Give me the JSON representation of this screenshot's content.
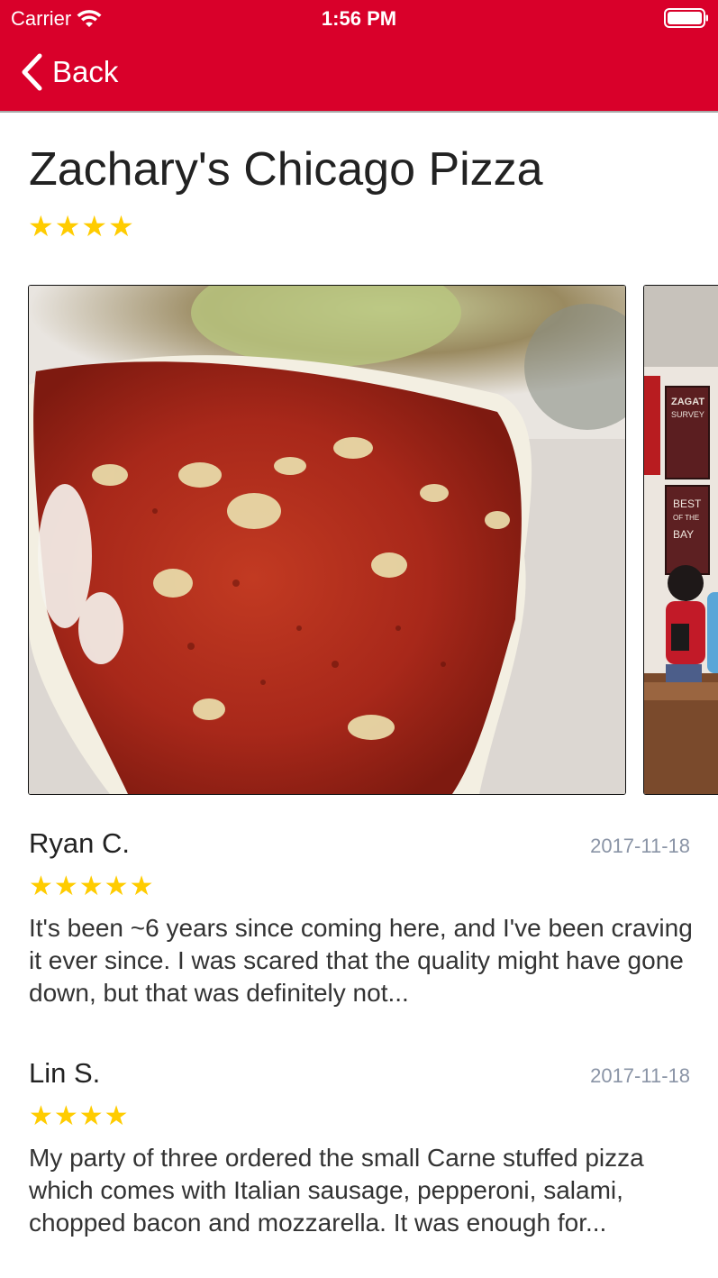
{
  "status_bar": {
    "carrier": "Carrier",
    "time": "1:56 PM"
  },
  "nav": {
    "back_label": "Back",
    "background_color": "#d9002a"
  },
  "restaurant": {
    "name": "Zachary's Chicago Pizza",
    "stars": "★★★★",
    "rating": 4
  },
  "photos": [
    {
      "description_icon": "pizza-slice-photo"
    },
    {
      "description_icon": "restaurant-interior-photo",
      "sign_text_1": "ZAGAT SURVEY",
      "sign_text_2": "BEST OF THE BAY"
    }
  ],
  "reviews": [
    {
      "author": "Ryan C.",
      "date": "2017-11-18",
      "stars": "★★★★★",
      "rating": 5,
      "text": "It's been ~6 years since coming here, and I've been craving it ever since. I was scared that the quality might have gone down, but that was definitely not..."
    },
    {
      "author": "Lin S.",
      "date": "2017-11-18",
      "stars": "★★★★",
      "rating": 4,
      "text": "My party of three ordered the small Carne stuffed pizza which comes with Italian sausage, pepperoni, salami, chopped bacon and mozzarella. It was enough for..."
    }
  ],
  "colors": {
    "accent": "#d9002a",
    "star": "#ffcc00",
    "date": "#8a94a6"
  }
}
